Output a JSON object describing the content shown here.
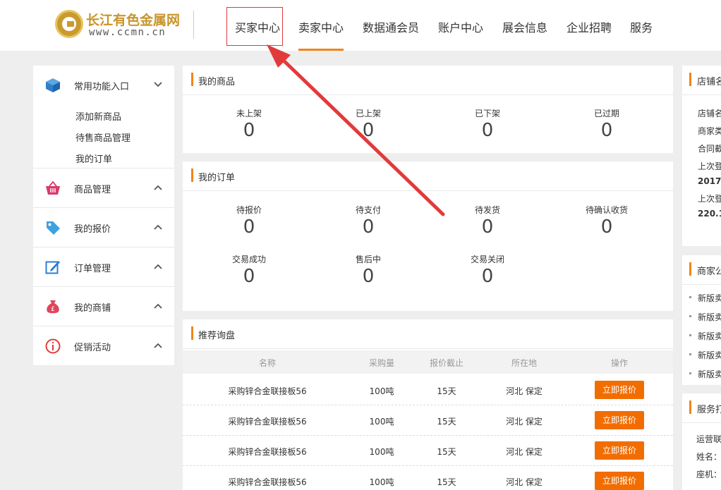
{
  "header": {
    "logo_name": "长江有色金属网",
    "logo_url": "www.ccmn.cn",
    "nav": [
      {
        "label": "买家中心"
      },
      {
        "label": "卖家中心"
      },
      {
        "label": "数据通会员"
      },
      {
        "label": "账户中心"
      },
      {
        "label": "展会信息"
      },
      {
        "label": "企业招聘"
      },
      {
        "label": "服务"
      }
    ],
    "accent_color": "#f08519",
    "highlight_color": "#e23a3a"
  },
  "sidebar": {
    "sections": [
      {
        "label": "常用功能入口",
        "icon": "cube-icon",
        "expanded": true,
        "items": [
          "添加新商品",
          "待售商品管理",
          "我的订单"
        ]
      },
      {
        "label": "商品管理",
        "icon": "basket-icon"
      },
      {
        "label": "我的报价",
        "icon": "tag-icon"
      },
      {
        "label": "订单管理",
        "icon": "edit-icon"
      },
      {
        "label": "我的商铺",
        "icon": "money-bag-icon"
      },
      {
        "label": "促销活动",
        "icon": "info-icon"
      }
    ]
  },
  "my_goods": {
    "title": "我的商品",
    "stats": [
      {
        "label": "未上架",
        "value": "0"
      },
      {
        "label": "已上架",
        "value": "0"
      },
      {
        "label": "已下架",
        "value": "0"
      },
      {
        "label": "已过期",
        "value": "0"
      }
    ]
  },
  "my_orders": {
    "title": "我的订单",
    "stats": [
      {
        "label": "待报价",
        "value": "0"
      },
      {
        "label": "待支付",
        "value": "0"
      },
      {
        "label": "待发货",
        "value": "0"
      },
      {
        "label": "待确认收货",
        "value": "0"
      },
      {
        "label": "交易成功",
        "value": "0"
      },
      {
        "label": "售后中",
        "value": "0"
      },
      {
        "label": "交易关闭",
        "value": "0"
      }
    ]
  },
  "inquiries": {
    "title": "推荐询盘",
    "columns": [
      "名称",
      "采购量",
      "报价截止",
      "所在地",
      "操作"
    ],
    "rows": [
      {
        "name": "采购锌合金联接板56",
        "qty": "100吨",
        "deadline": "15天",
        "location": "河北 保定",
        "action": "立即报价"
      },
      {
        "name": "采购锌合金联接板56",
        "qty": "100吨",
        "deadline": "15天",
        "location": "河北 保定",
        "action": "立即报价"
      },
      {
        "name": "采购锌合金联接板56",
        "qty": "100吨",
        "deadline": "15天",
        "location": "河北 保定",
        "action": "立即报价"
      },
      {
        "name": "采购锌合金联接板56",
        "qty": "100吨",
        "deadline": "15天",
        "location": "河北 保定",
        "action": "立即报价"
      }
    ]
  },
  "shop_info": {
    "title": "店铺名",
    "lines": [
      "店铺名",
      "商家类",
      "合同截",
      "上次登",
      "2017-",
      "上次登",
      "220.1"
    ]
  },
  "merchant_notice": {
    "title": "商家公",
    "items": [
      "新版卖",
      "新版卖",
      "新版卖",
      "新版卖",
      "新版卖"
    ]
  },
  "service": {
    "title": "服务打",
    "lines": [
      "运营联",
      "姓名：",
      "座机："
    ]
  }
}
